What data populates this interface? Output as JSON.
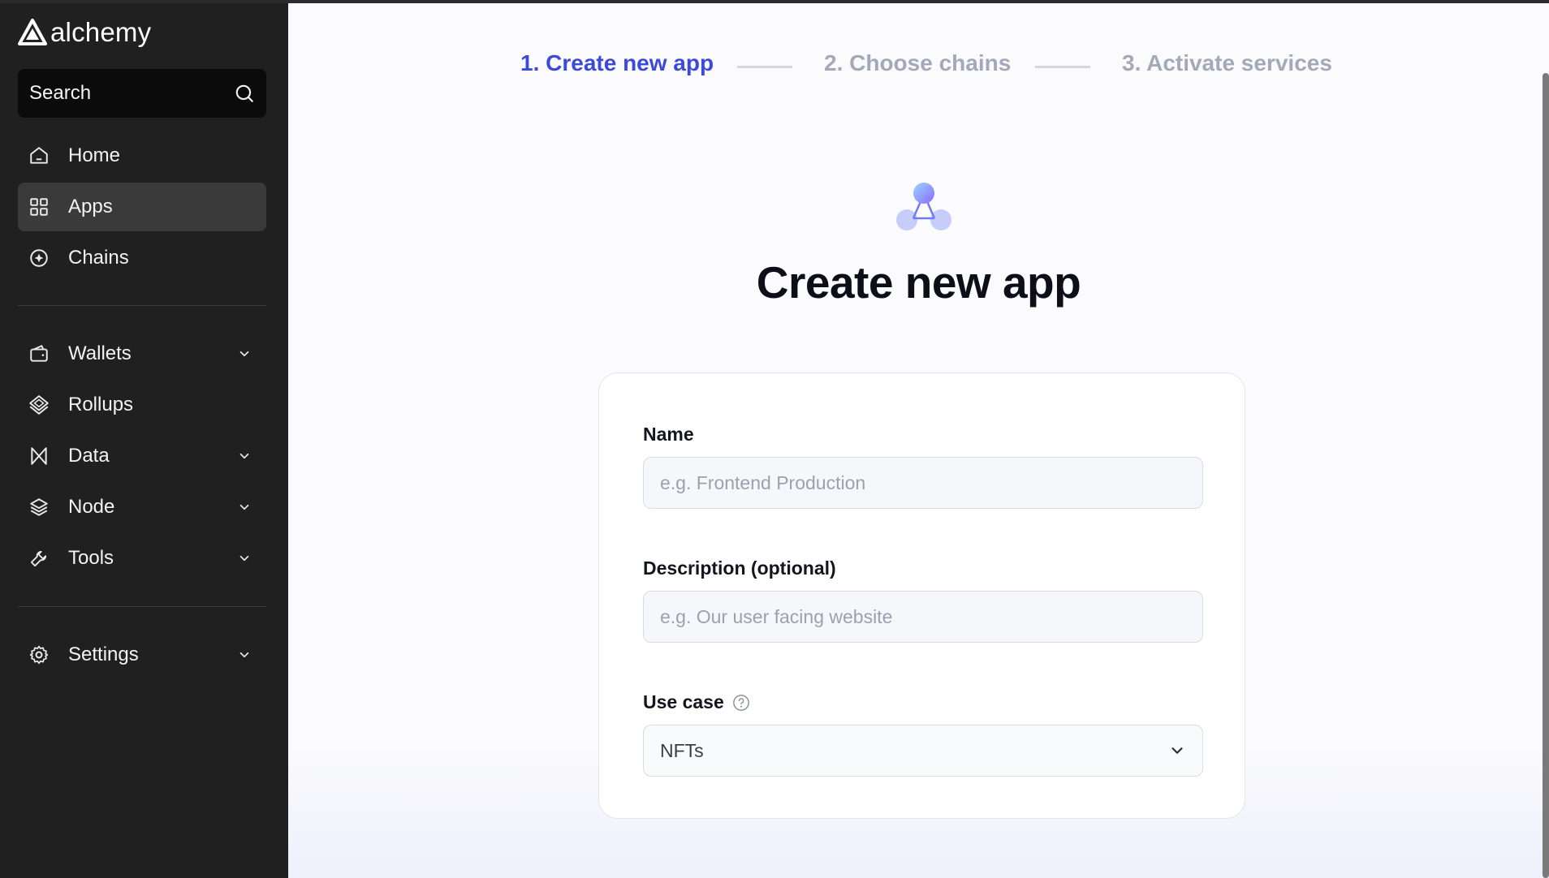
{
  "sidebar": {
    "logo_text": "alchemy",
    "search_label": "Search",
    "items": [
      {
        "label": "Home",
        "icon": "home-icon"
      },
      {
        "label": "Apps",
        "icon": "grid-icon",
        "active": true
      },
      {
        "label": "Chains",
        "icon": "chains-icon"
      },
      {
        "label": "Wallets",
        "icon": "wallet-icon",
        "expandable": true
      },
      {
        "label": "Rollups",
        "icon": "layers-diamond-icon"
      },
      {
        "label": "Data",
        "icon": "data-icon",
        "expandable": true
      },
      {
        "label": "Node",
        "icon": "stack-icon",
        "expandable": true
      },
      {
        "label": "Tools",
        "icon": "wrench-icon",
        "expandable": true
      },
      {
        "label": "Settings",
        "icon": "gear-icon",
        "expandable": true
      }
    ]
  },
  "steps": [
    {
      "label": "1. Create new app",
      "state": "active"
    },
    {
      "label": "2. Choose chains",
      "state": "inactive"
    },
    {
      "label": "3. Activate services",
      "state": "inactive"
    }
  ],
  "main": {
    "title": "Create new app",
    "form": {
      "name_label": "Name",
      "name_placeholder": "e.g. Frontend Production",
      "description_label": "Description (optional)",
      "description_placeholder": "e.g. Our user facing website",
      "use_case_label": "Use case",
      "use_case_value": "NFTs"
    }
  },
  "colors": {
    "accent": "#3b4ad9",
    "sidebar_bg": "#202020",
    "active_item_bg": "#3a3a3a"
  }
}
